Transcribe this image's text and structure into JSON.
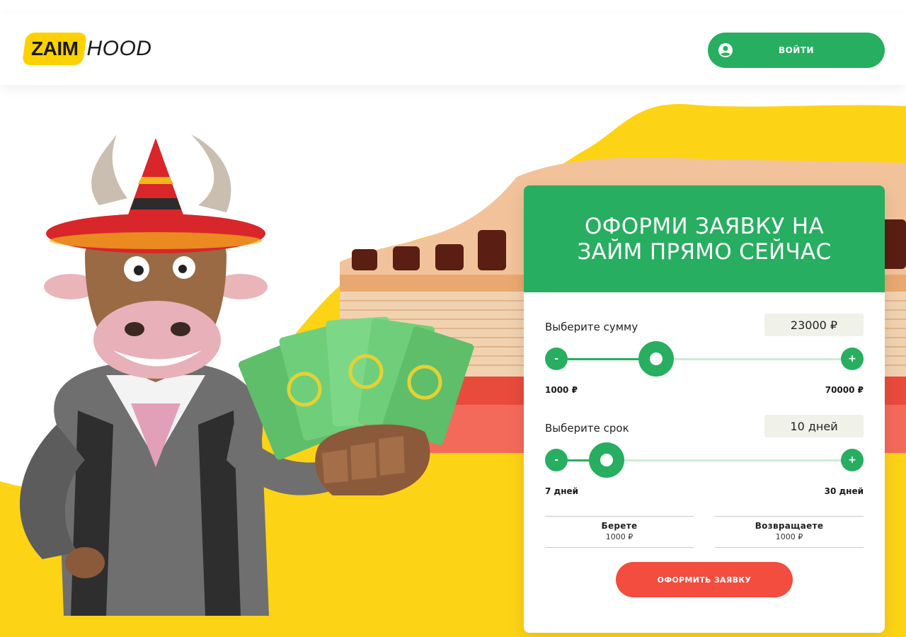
{
  "header": {
    "logo_left": "ZAIM",
    "logo_right": "HOOD",
    "login_label": "ВОЙТИ"
  },
  "form": {
    "title": "ОФОРМИ ЗАЯВКУ НА ЗАЙМ ПРЯМО СЕЙЧАС",
    "amount": {
      "label": "Выберите сумму",
      "value": "23000 ₽",
      "min_label": "1000 ₽",
      "max_label": "70000 ₽",
      "min": 1000,
      "max": 70000,
      "current": 23000,
      "minus": "-",
      "plus": "+"
    },
    "term": {
      "label": "Выберите срок",
      "value": "10 дней",
      "min_label": "7 дней",
      "max_label": "30 дней",
      "min": 7,
      "max": 30,
      "current": 10,
      "minus": "-",
      "plus": "+"
    },
    "borrow": {
      "title": "Берете",
      "value": "1000 ₽"
    },
    "repay": {
      "title": "Возвращаете",
      "value": "1000 ₽"
    },
    "submit_label": "ОФОРМИТЬ ЗАЯВКУ"
  },
  "colors": {
    "primary_green": "#27ae60",
    "accent_yellow": "#fdd100",
    "submit_red": "#f24d3f"
  }
}
